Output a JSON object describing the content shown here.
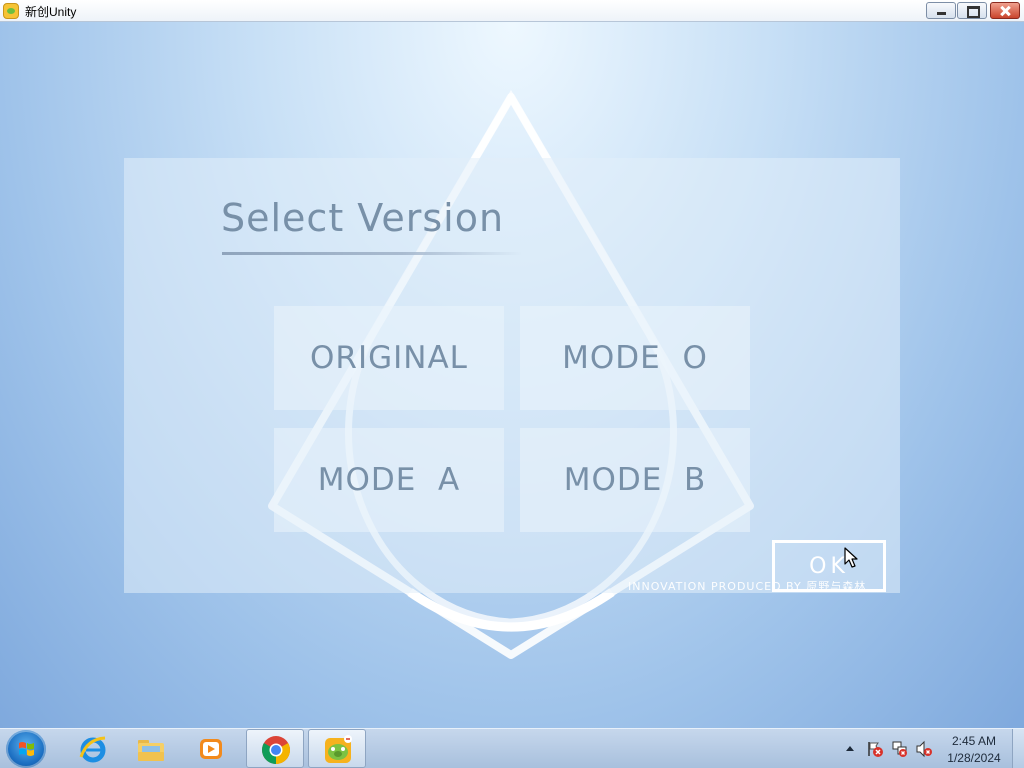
{
  "window": {
    "title": "新创Unity",
    "icon": "app-icon",
    "controls": [
      "minimize-icon",
      "maximize-icon",
      "close-icon"
    ]
  },
  "dialog": {
    "heading": "Select Version",
    "modes": {
      "original": "ORIGINAL",
      "mode_o": "MODE  O",
      "mode_a": "MODE  A",
      "mode_b": "MODE  B"
    },
    "ok_label": "OK",
    "credit": "INNOVATION PRODUCED BY 原野与森林"
  },
  "taskbar": {
    "items": [
      "start-orb-icon",
      "internet-explorer-icon",
      "file-explorer-icon",
      "media-player-icon",
      "chrome-icon",
      "unity-game-icon"
    ],
    "tray": [
      "show-hidden-icons-icon",
      "action-center-icon",
      "network-icon",
      "volume-muted-icon"
    ],
    "clock": {
      "time": "2:45 AM",
      "date": "1/28/2024"
    }
  },
  "colors": {
    "text_muted": "#7890a8",
    "ok_border": "#ffffff",
    "background_top": "#eef8ff",
    "background_bottom": "#7fa9dd"
  }
}
